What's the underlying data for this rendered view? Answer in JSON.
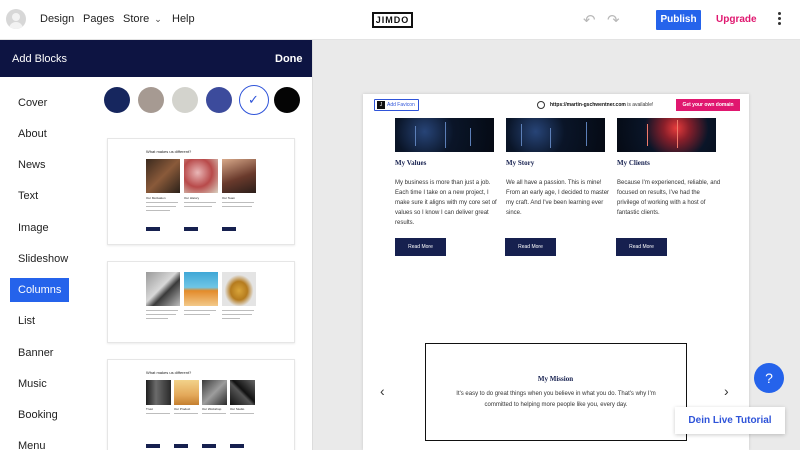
{
  "topbar": {
    "nav": [
      "Design",
      "Pages",
      "Store",
      "Help"
    ],
    "logo": "JIMDO",
    "publish": "Publish",
    "upgrade": "Upgrade",
    "store_chevron": "chevron-down-icon"
  },
  "panel": {
    "title": "Add Blocks",
    "done": "Done",
    "categories": [
      "Cover",
      "About",
      "News",
      "Text",
      "Image",
      "Slideshow",
      "Columns",
      "List",
      "Banner",
      "Music",
      "Booking",
      "Menu"
    ],
    "active_category": "Columns",
    "swatches": [
      "#16265e",
      "#a69a92",
      "#d3d3cd",
      "#3c4b9c",
      "#ffffff",
      "#050505"
    ],
    "selected_swatch_index": 4,
    "thumb1": {
      "title": "What makes us different?",
      "captions": [
        "Our Motivation",
        "Our History",
        "Our Team"
      ],
      "buttons": [
        "Read More",
        "Read More",
        "Read More"
      ]
    },
    "thumb3": {
      "title": "What makes us different?",
      "captions": [
        "Trust",
        "Our Product",
        "Our Workshop",
        "Our Studio"
      ],
      "buttons": [
        "Read More",
        "Read More",
        "Read More",
        "Read More"
      ]
    }
  },
  "preview": {
    "favicon": "Add Favicon",
    "favicon_icon": "J",
    "domain_url": "https://martin-gschwentner.com",
    "domain_suffix": " is available!",
    "get_domain": "Get your own domain",
    "columns": [
      {
        "title": "My Values",
        "text": "My business is more than just a job. Each time I take on a new project, I make sure it aligns with my core set of values so I know I can deliver great results.",
        "button": "Read More"
      },
      {
        "title": "My Story",
        "text": "We all have a passion. This is mine! From an early age, I decided to master my craft. And I've been learning ever since.",
        "button": "Read More"
      },
      {
        "title": "My Clients",
        "text": "Because I'm experienced, reliable, and focused on results, I've had the privilege of working with a host of fantastic clients.",
        "button": "Read More"
      }
    ],
    "mission": {
      "title": "My Mission",
      "text": "It's easy to do great things when you believe in what you do. That's why I'm committed to helping more people like you, every day."
    },
    "prev_arrow": "‹",
    "next_arrow": "›"
  },
  "help": "?",
  "tutorial": "Dein Live Tutorial"
}
